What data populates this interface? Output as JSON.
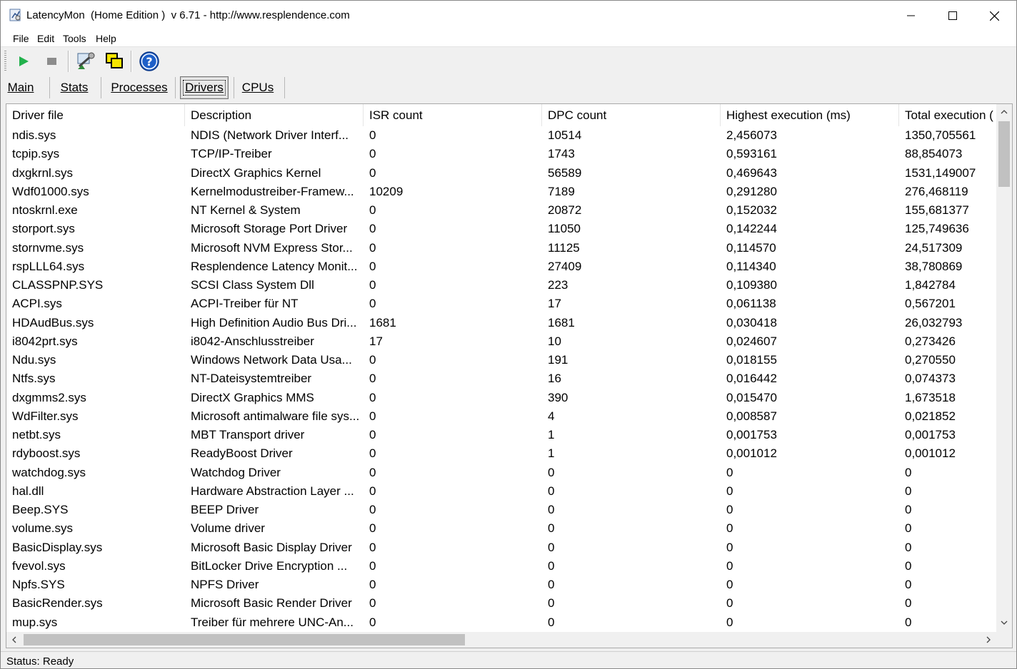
{
  "window": {
    "title": "LatencyMon  (Home Edition )  v 6.71 - http://www.resplendence.com"
  },
  "menu": [
    "File",
    "Edit",
    "Tools",
    "Help"
  ],
  "toolbar": {
    "buttons": [
      "play-icon",
      "stop-icon",
      "tools-icon",
      "windows-icon",
      "help-icon"
    ]
  },
  "tabs": [
    "Main",
    "Stats",
    "Processes",
    "Drivers",
    "CPUs"
  ],
  "active_tab": "Drivers",
  "table": {
    "columns": [
      "Driver file",
      "Description",
      "ISR count",
      "DPC count",
      "Highest execution (ms)",
      "Total execution ("
    ],
    "rows": [
      [
        "ndis.sys",
        "NDIS (Network Driver Interf...",
        "0",
        "10514",
        "2,456073",
        "1350,705561"
      ],
      [
        "tcpip.sys",
        "TCP/IP-Treiber",
        "0",
        "1743",
        "0,593161",
        "88,854073"
      ],
      [
        "dxgkrnl.sys",
        "DirectX Graphics Kernel",
        "0",
        "56589",
        "0,469643",
        "1531,149007"
      ],
      [
        "Wdf01000.sys",
        "Kernelmodustreiber-Framew...",
        "10209",
        "7189",
        "0,291280",
        "276,468119"
      ],
      [
        "ntoskrnl.exe",
        "NT Kernel & System",
        "0",
        "20872",
        "0,152032",
        "155,681377"
      ],
      [
        "storport.sys",
        "Microsoft Storage Port Driver",
        "0",
        "11050",
        "0,142244",
        "125,749636"
      ],
      [
        "stornvme.sys",
        "Microsoft NVM Express Stor...",
        "0",
        "11125",
        "0,114570",
        "24,517309"
      ],
      [
        "rspLLL64.sys",
        "Resplendence Latency Monit...",
        "0",
        "27409",
        "0,114340",
        "38,780869"
      ],
      [
        "CLASSPNP.SYS",
        "SCSI Class System Dll",
        "0",
        "223",
        "0,109380",
        "1,842784"
      ],
      [
        "ACPI.sys",
        "ACPI-Treiber für NT",
        "0",
        "17",
        "0,061138",
        "0,567201"
      ],
      [
        "HDAudBus.sys",
        "High Definition Audio Bus Dri...",
        "1681",
        "1681",
        "0,030418",
        "26,032793"
      ],
      [
        "i8042prt.sys",
        "i8042-Anschlusstreiber",
        "17",
        "10",
        "0,024607",
        "0,273426"
      ],
      [
        "Ndu.sys",
        "Windows Network Data Usa...",
        "0",
        "191",
        "0,018155",
        "0,270550"
      ],
      [
        "Ntfs.sys",
        "NT-Dateisystemtreiber",
        "0",
        "16",
        "0,016442",
        "0,074373"
      ],
      [
        "dxgmms2.sys",
        "DirectX Graphics MMS",
        "0",
        "390",
        "0,015470",
        "1,673518"
      ],
      [
        "WdFilter.sys",
        "Microsoft antimalware file sys...",
        "0",
        "4",
        "0,008587",
        "0,021852"
      ],
      [
        "netbt.sys",
        "MBT Transport driver",
        "0",
        "1",
        "0,001753",
        "0,001753"
      ],
      [
        "rdyboost.sys",
        "ReadyBoost Driver",
        "0",
        "1",
        "0,001012",
        "0,001012"
      ],
      [
        "watchdog.sys",
        "Watchdog Driver",
        "0",
        "0",
        "0",
        "0"
      ],
      [
        "hal.dll",
        "Hardware Abstraction Layer ...",
        "0",
        "0",
        "0",
        "0"
      ],
      [
        "Beep.SYS",
        "BEEP Driver",
        "0",
        "0",
        "0",
        "0"
      ],
      [
        "volume.sys",
        "Volume driver",
        "0",
        "0",
        "0",
        "0"
      ],
      [
        "BasicDisplay.sys",
        "Microsoft Basic Display Driver",
        "0",
        "0",
        "0",
        "0"
      ],
      [
        "fvevol.sys",
        "BitLocker Drive Encryption ...",
        "0",
        "0",
        "0",
        "0"
      ],
      [
        "Npfs.SYS",
        "NPFS Driver",
        "0",
        "0",
        "0",
        "0"
      ],
      [
        "BasicRender.sys",
        "Microsoft Basic Render Driver",
        "0",
        "0",
        "0",
        "0"
      ],
      [
        "mup.sys",
        "Treiber für mehrere UNC-An...",
        "0",
        "0",
        "0",
        "0"
      ]
    ]
  },
  "status": "Status: Ready",
  "colors": {
    "play": "#22b14c",
    "help": "#1e5fc8",
    "scroll_thumb": "#c1c1c1"
  }
}
